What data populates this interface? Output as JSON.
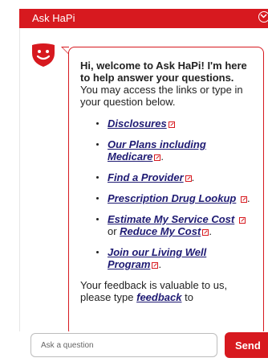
{
  "header": {
    "title": "Ask HaPi",
    "collapse_icon": "chevron-down-circle-icon"
  },
  "colors": {
    "brand_red": "#d7191f",
    "link_navy": "#1e1a73"
  },
  "message": {
    "greeting_bold": "Hi, welcome to Ask HaPi! I'm here to help answer your questions.",
    "greeting_rest": " You may access the links or type in your question below.",
    "links": [
      {
        "label": "Disclosures",
        "icon": "external-link-icon"
      },
      {
        "label": "Our Plans including Medicare",
        "icon": "external-link-icon",
        "suffix": "."
      },
      {
        "label": "Find a Provider",
        "icon": "external-link-icon",
        "suffix": "."
      },
      {
        "label": "Prescription Drug Lookup",
        "icon": "external-link-icon",
        "suffix": "."
      },
      {
        "label": "Estimate My Service Cost",
        "icon": "external-link-icon",
        "joiner": " or ",
        "label_2": "Reduce My Cost",
        "suffix": "."
      },
      {
        "label": "Join our Living Well Program",
        "icon": "external-link-icon",
        "suffix": "."
      }
    ],
    "feedback_text": "Your feedback is valuable to us, please type ",
    "feedback_link": "feedback",
    "feedback_tail": " to"
  },
  "input": {
    "placeholder": "Ask a question",
    "value": ""
  },
  "send_button": {
    "label": "Send"
  },
  "avatar": {
    "icon": "smiley-shield-icon"
  }
}
